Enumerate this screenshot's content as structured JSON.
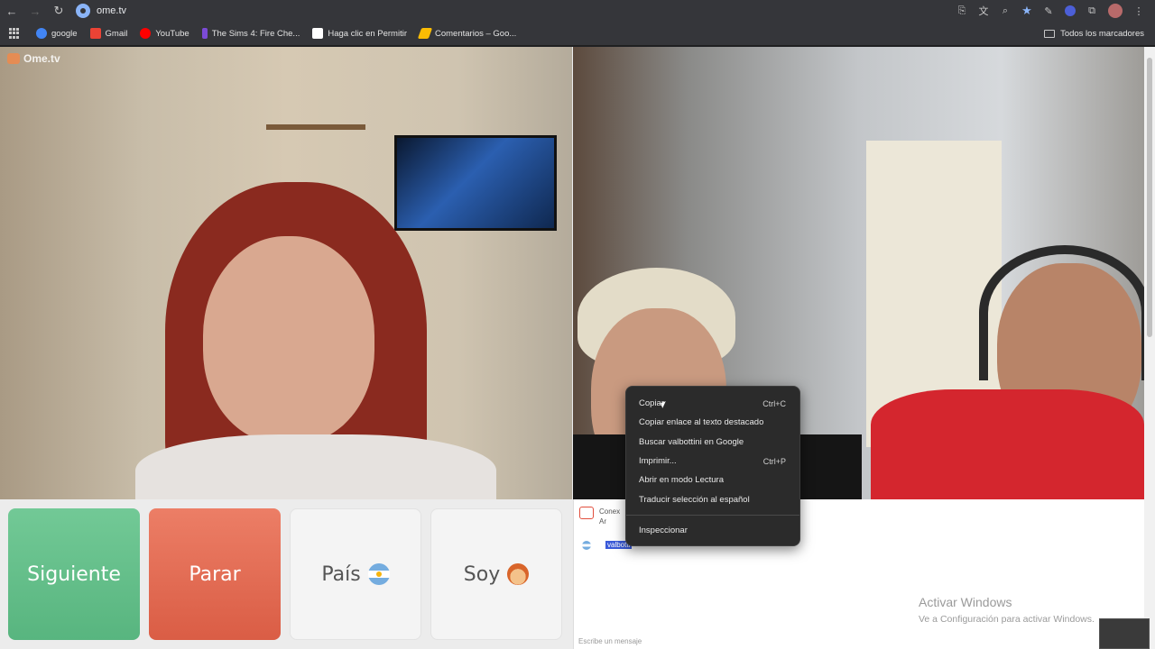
{
  "browser": {
    "url": "ome.tv",
    "bookmarks": [
      {
        "label": "google",
        "icon": "google-icon",
        "color": "#4285f4"
      },
      {
        "label": "Gmail",
        "icon": "gmail-icon",
        "color": "#ea4335"
      },
      {
        "label": "YouTube",
        "icon": "youtube-icon",
        "color": "#ff0000"
      },
      {
        "label": "The Sims 4: Fire Che...",
        "icon": "sims-icon",
        "color": "#7b4bd6"
      },
      {
        "label": "Haga clic en Permitir",
        "icon": "page-icon",
        "color": "#ffffff"
      },
      {
        "label": "Comentarios – Goo...",
        "icon": "ads-icon",
        "color": "#fbbc04"
      }
    ],
    "all_bookmarks_label": "Todos los marcadores"
  },
  "site": {
    "logo_text": "Ome.tv"
  },
  "controls": {
    "next_label": "Siguiente",
    "stop_label": "Parar",
    "country_label": "País",
    "gender_label": "Soy"
  },
  "chat": {
    "system_text": "Conex",
    "system_sub": "Ar",
    "selected_text": "valbotti",
    "input_placeholder": "Escribe un mensaje"
  },
  "windows_watermark": {
    "title": "Activar Windows",
    "subtitle": "Ve a Configuración para activar Windows."
  },
  "context_menu": {
    "items": [
      {
        "label": "Copiar",
        "shortcut": "Ctrl+C"
      },
      {
        "label": "Copiar enlace al texto destacado",
        "shortcut": ""
      },
      {
        "label": "Buscar valbottini en Google",
        "shortcut": ""
      },
      {
        "label": "Imprimir...",
        "shortcut": "Ctrl+P"
      },
      {
        "label": "Abrir en modo Lectura",
        "shortcut": ""
      },
      {
        "label": "Traducir selección al español",
        "shortcut": ""
      }
    ],
    "inspect_label": "Inspeccionar"
  },
  "colors": {
    "next_button": "#5fbd88",
    "stop_button": "#e06a51",
    "selection": "#3a5ad9"
  }
}
